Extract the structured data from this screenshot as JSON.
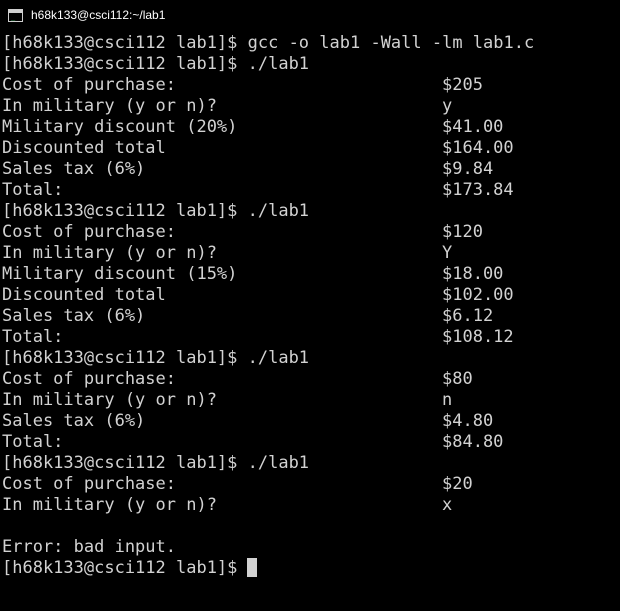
{
  "window": {
    "title": "h68k133@csci112:~/lab1",
    "icon": "terminal-icon",
    "icon_glyph": "_"
  },
  "terminal": {
    "lines": [
      {
        "kind": "command",
        "text": "[h68k133@csci112 lab1]$ gcc -o lab1 -Wall -lm lab1.c"
      },
      {
        "kind": "command",
        "text": "[h68k133@csci112 lab1]$ ./lab1"
      },
      {
        "kind": "output",
        "label": "Cost of purchase:",
        "value": "$205"
      },
      {
        "kind": "output",
        "label": "In military (y or n)?",
        "value": "y"
      },
      {
        "kind": "output",
        "label": "Military discount (20%)",
        "value": "$41.00"
      },
      {
        "kind": "output",
        "label": "Discounted total",
        "value": "$164.00"
      },
      {
        "kind": "output",
        "label": "Sales tax (6%)",
        "value": "$9.84"
      },
      {
        "kind": "output",
        "label": "Total:",
        "value": "$173.84"
      },
      {
        "kind": "command",
        "text": "[h68k133@csci112 lab1]$ ./lab1"
      },
      {
        "kind": "output",
        "label": "Cost of purchase:",
        "value": "$120"
      },
      {
        "kind": "output",
        "label": "In military (y or n)?",
        "value": "Y"
      },
      {
        "kind": "output",
        "label": "Military discount (15%)",
        "value": "$18.00"
      },
      {
        "kind": "output",
        "label": "Discounted total",
        "value": "$102.00"
      },
      {
        "kind": "output",
        "label": "Sales tax (6%)",
        "value": "$6.12"
      },
      {
        "kind": "output",
        "label": "Total:",
        "value": "$108.12"
      },
      {
        "kind": "command",
        "text": "[h68k133@csci112 lab1]$ ./lab1"
      },
      {
        "kind": "output",
        "label": "Cost of purchase:",
        "value": "$80"
      },
      {
        "kind": "output",
        "label": "In military (y or n)?",
        "value": "n"
      },
      {
        "kind": "output",
        "label": "Sales tax (6%)",
        "value": "$4.80"
      },
      {
        "kind": "output",
        "label": "Total:",
        "value": "$84.80"
      },
      {
        "kind": "command",
        "text": "[h68k133@csci112 lab1]$ ./lab1"
      },
      {
        "kind": "output",
        "label": "Cost of purchase:",
        "value": "$20"
      },
      {
        "kind": "output",
        "label": "In military (y or n)?",
        "value": "x"
      },
      {
        "kind": "blank",
        "text": ""
      },
      {
        "kind": "text",
        "text": "Error: bad input."
      },
      {
        "kind": "prompt",
        "text": "[h68k133@csci112 lab1]$"
      }
    ]
  },
  "colors": {
    "background": "#000000",
    "foreground": "#d2d2d2",
    "title_text": "#ffffff"
  }
}
